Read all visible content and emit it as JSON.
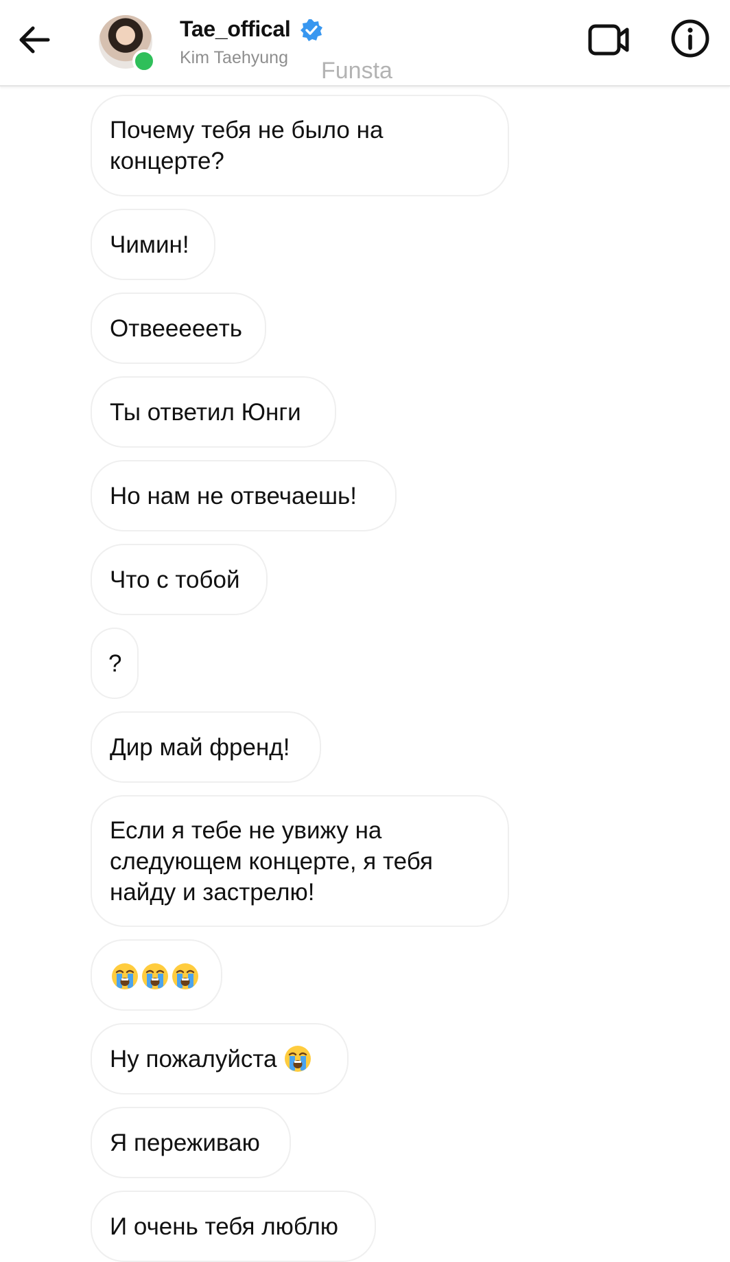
{
  "header": {
    "username": "Tae_offical",
    "full_name": "Kim Taehyung",
    "watermark": "Funsta",
    "icons": {
      "back": "arrow-left-icon",
      "verified": "verified-badge-icon",
      "video": "video-camera-icon",
      "info": "info-icon"
    },
    "colors": {
      "verified": "#3897f0",
      "online": "#2fbf5a"
    }
  },
  "messages": [
    {
      "text": "Почему тебя не было на\nконцерте?"
    },
    {
      "text": "Чимин!"
    },
    {
      "text": "Отвееееeть"
    },
    {
      "text": "Ты ответил Юнги"
    },
    {
      "text": "Но нам не отвечаешь!"
    },
    {
      "text": "Что с тобой"
    },
    {
      "text": "?"
    },
    {
      "text": "Дир май френд!"
    },
    {
      "text": "Если я тебе не увижу на\nследующем концерте, я тебя\nнайду и застрелю!"
    },
    {
      "text": "",
      "emoji": [
        "loudly-crying-face",
        "loudly-crying-face",
        "loudly-crying-face"
      ]
    },
    {
      "text": "Ну пожалуйста",
      "emoji": [
        "loudly-crying-face"
      ]
    },
    {
      "text": "Я переживаю"
    },
    {
      "text": "И очень тебя люблю"
    }
  ]
}
